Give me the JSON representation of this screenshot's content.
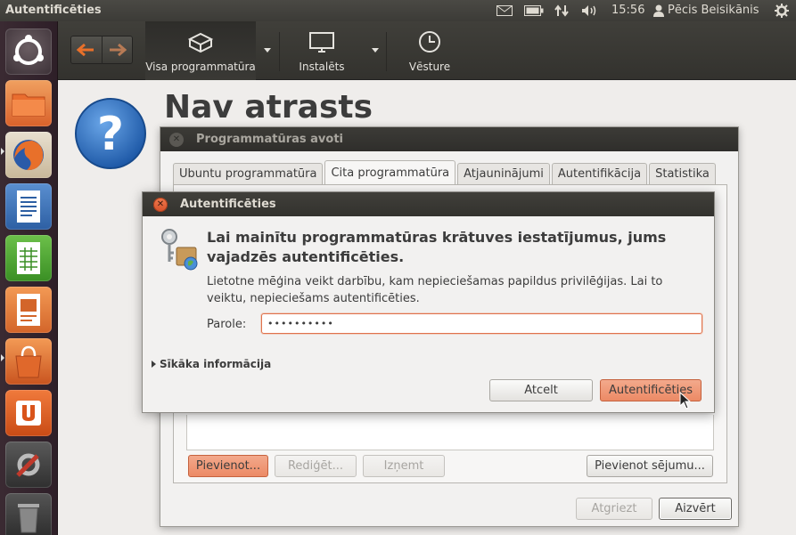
{
  "top_panel": {
    "title": "Autentificēties",
    "clock": "15:56",
    "user": "Pēcis Beisikānis",
    "icons": [
      "mail-icon",
      "battery-icon",
      "network-icon",
      "volume-icon",
      "user-icon",
      "power-gear-icon"
    ]
  },
  "launcher": {
    "items": [
      "dash-home",
      "files",
      "firefox",
      "writer",
      "calc",
      "impress",
      "software-center",
      "ubuntu-one",
      "system-settings",
      "trash"
    ]
  },
  "toolbar": {
    "items": [
      {
        "label": "Visa programmatūra",
        "icon": "all-software-icon"
      },
      {
        "label": "Instalēts",
        "icon": "installed-monitor-icon"
      },
      {
        "label": "Vēsture",
        "icon": "history-clock-icon"
      }
    ]
  },
  "main": {
    "heading": "Nav atrasts"
  },
  "sources_window": {
    "title": "Programmatūras avoti",
    "tabs": [
      "Ubuntu programmatūra",
      "Cita programmatūra",
      "Atjauninājumi",
      "Autentifikācija",
      "Statistika"
    ],
    "active_tab": "Cita programmatūra",
    "buttons": {
      "add": "Pievienot...",
      "edit": "Rediģēt...",
      "remove": "Izņemt",
      "add_volume": "Pievienot sējumu...",
      "revert": "Atgriezt",
      "close": "Aizvērt"
    }
  },
  "auth_dialog": {
    "title": "Autentificēties",
    "heading": "Lai mainītu programmatūras krātuves iestatījumus, jums vajadzēs autentificēties.",
    "body": "Lietotne mēģina veikt darbību, kam nepieciešamas papildus privilēģijas. Lai to veiktu, nepieciešams autentificēties.",
    "password_label": "Parole:",
    "password_value": "••••••••••",
    "details": "Sīkāka informācija",
    "cancel": "Atcelt",
    "authenticate": "Autentificēties"
  },
  "colors": {
    "accent_orange": "#ec8a65",
    "panel_dark": "#3c3b37",
    "launcher_bg": "#2e1f28"
  }
}
